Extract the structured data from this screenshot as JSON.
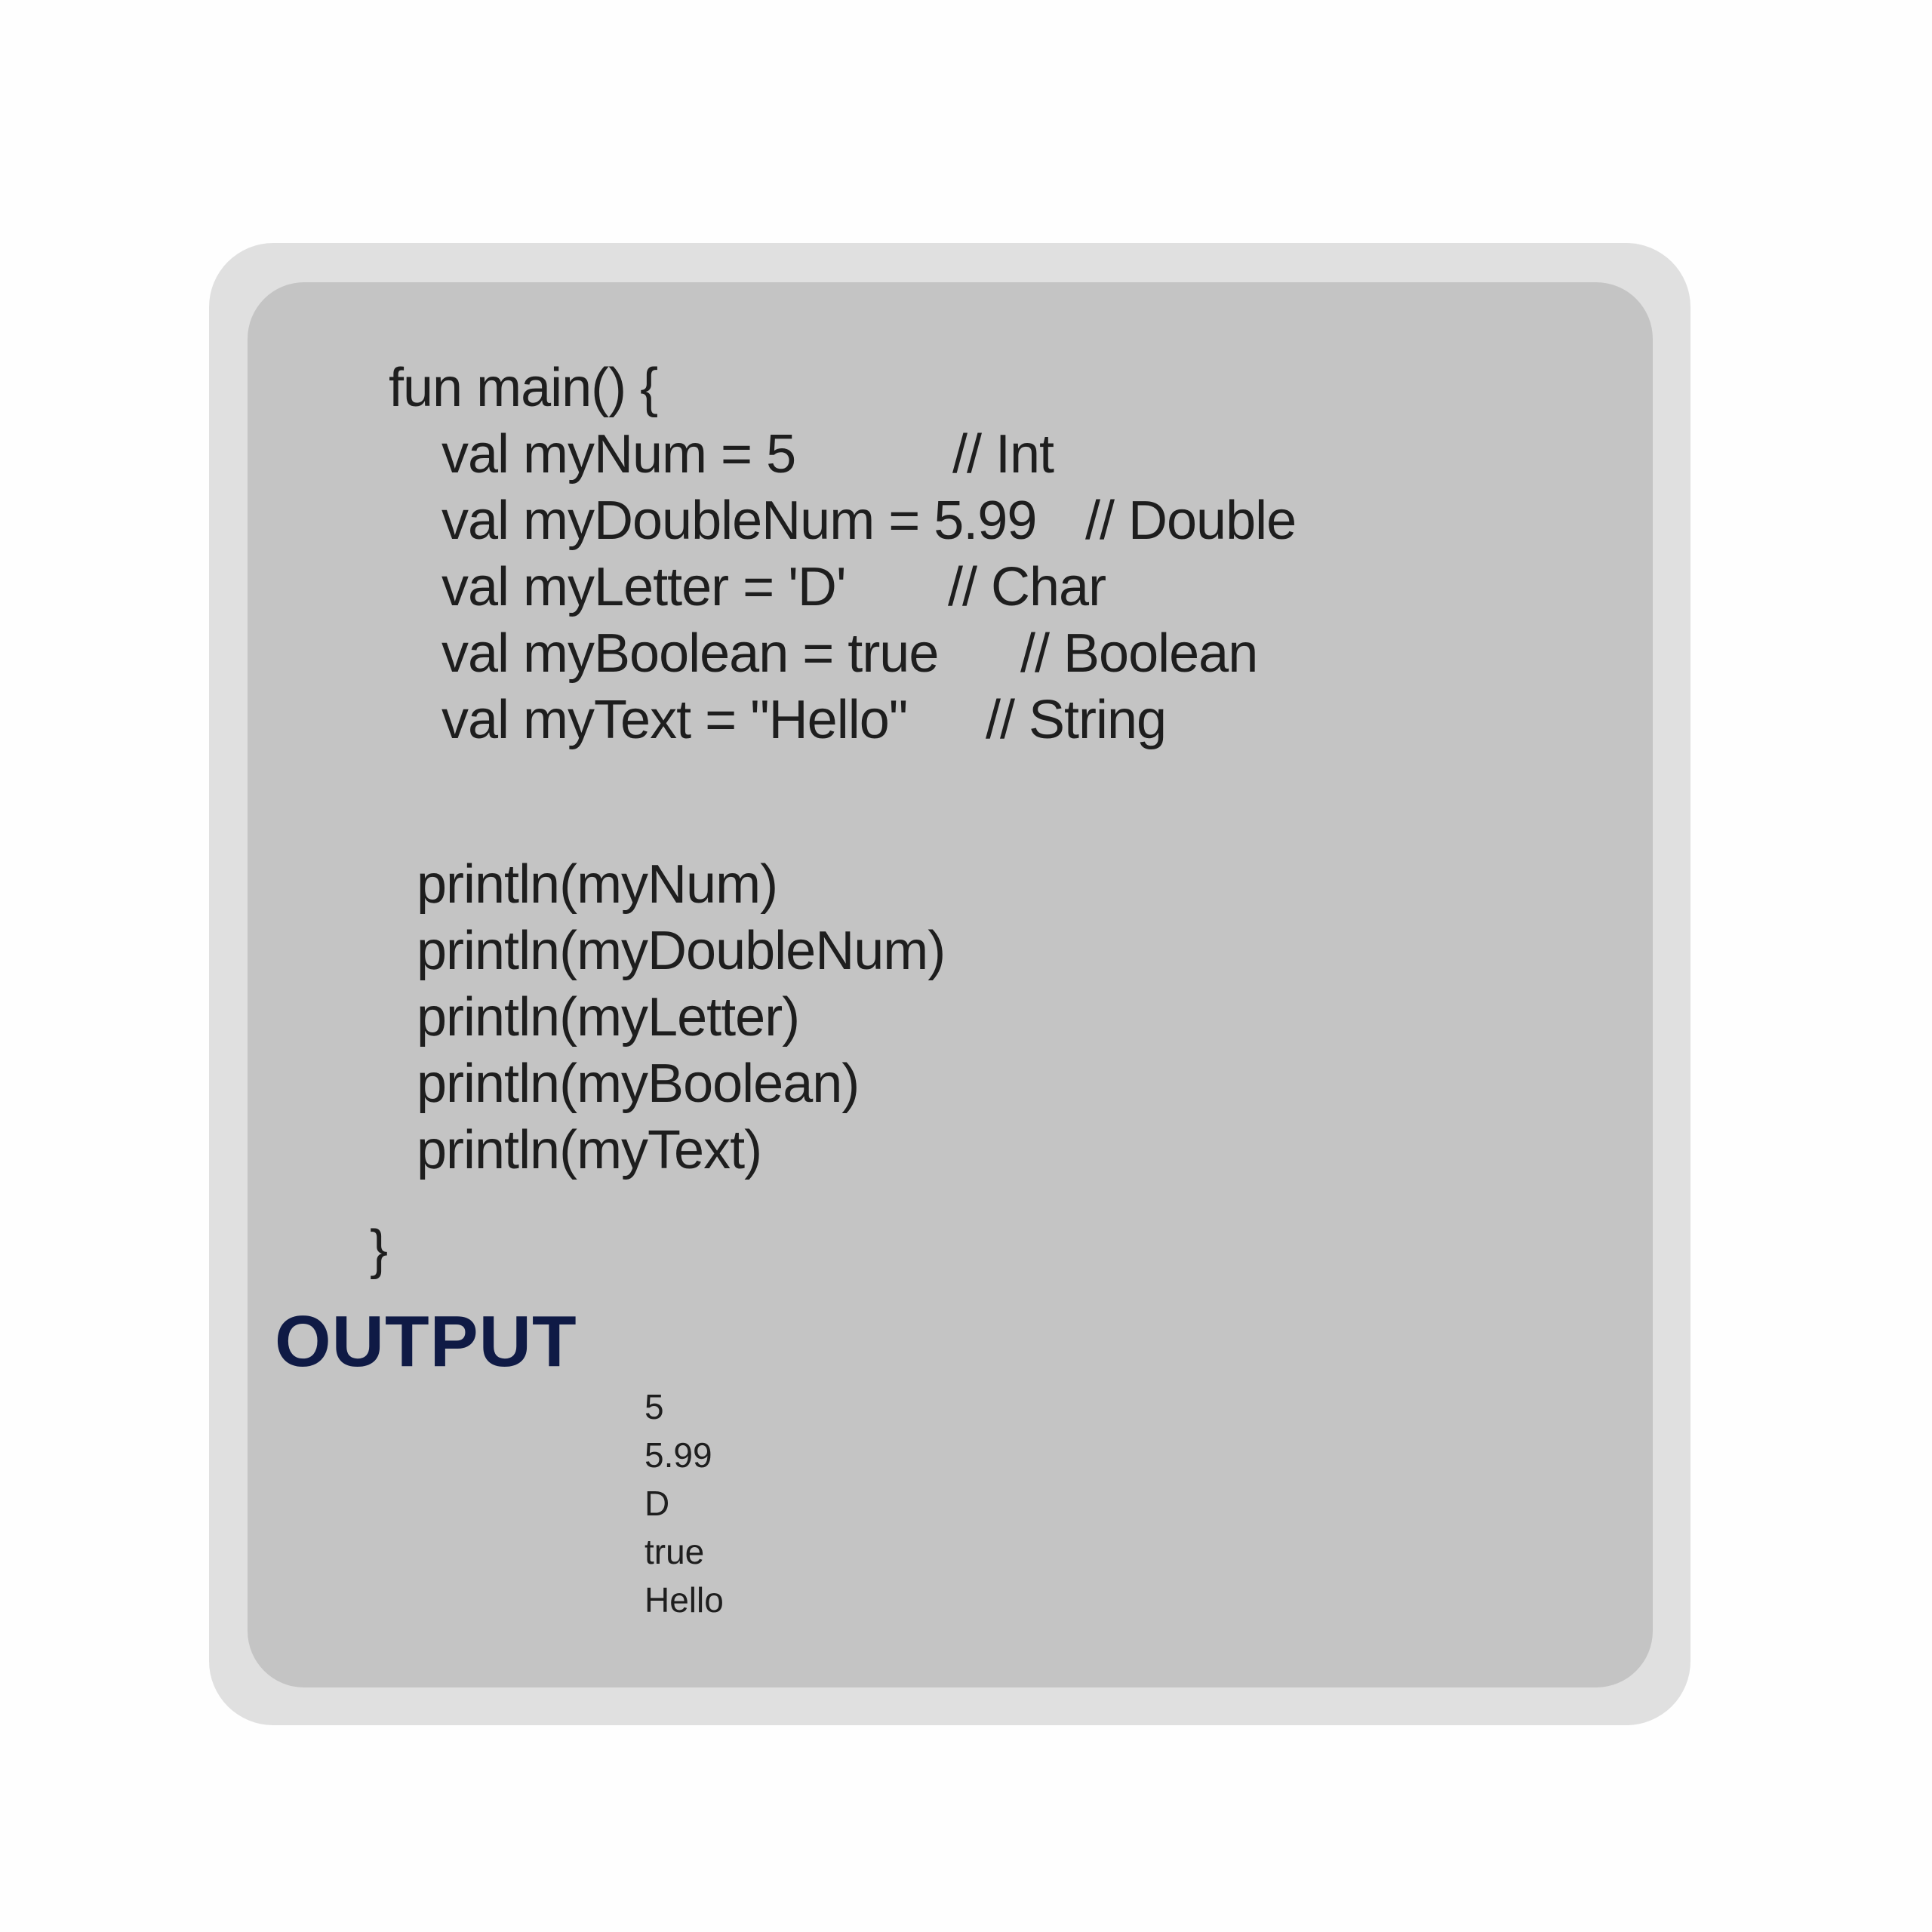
{
  "code": {
    "open": "fun main() {",
    "declarations": [
      {
        "code": "val myNum = 5",
        "comment": "// Int"
      },
      {
        "code": "val myDoubleNum = 5.99",
        "comment": "// Double"
      },
      {
        "code": "val myLetter = 'D'",
        "comment": "// Char"
      },
      {
        "code": "val myBoolean = true",
        "comment": "// Boolean"
      },
      {
        "code": "val myText = \"Hello\"",
        "comment": "// String"
      }
    ],
    "prints": [
      "println(myNum)",
      "println(myDoubleNum)",
      "println(myLetter)",
      "println(myBoolean)",
      "println(myText)"
    ],
    "close": "}"
  },
  "output": {
    "title": "OUTPUT",
    "lines": [
      "5",
      "5.99",
      "D",
      "true",
      "Hello"
    ]
  }
}
